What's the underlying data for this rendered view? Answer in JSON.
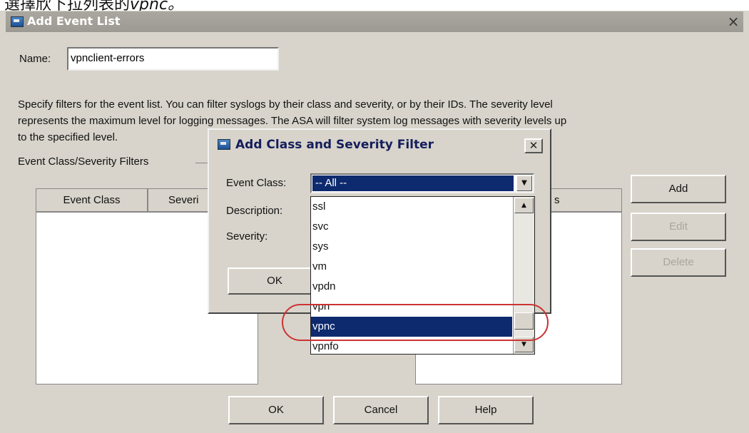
{
  "caption": {
    "prefix": "選擇欣下拉列表的",
    "italic": "vpnc。"
  },
  "main_dialog": {
    "title": "Add Event List",
    "close_glyph": "×",
    "name_label": "Name:",
    "name_value": "vpnclient-errors",
    "description_lines": [
      "Specify filters for the event list. You can filter syslogs by their class and severity, or by their IDs. The severity level",
      "represents the maximum level for logging messages. The ASA will filter system log messages with severity levels up",
      "to the specified level."
    ],
    "group_label": "Event Class/Severity Filters",
    "table_headers": [
      "Event Class",
      "Severi"
    ],
    "ids_header_partial": "s",
    "buttons": {
      "add": "Add",
      "edit": "Edit",
      "delete": "Delete"
    },
    "footer": {
      "ok": "OK",
      "cancel": "Cancel",
      "help": "Help"
    }
  },
  "sub_dialog": {
    "title": "Add Class and Severity Filter",
    "close_glyph": "✕",
    "event_class_label": "Event Class:",
    "event_class_value": "-- All --",
    "description_label": "Description:",
    "severity_label": "Severity:",
    "ok": "OK"
  },
  "dropdown": {
    "items": [
      "ssl",
      "svc",
      "sys",
      "vm",
      "vpdn",
      "vpn",
      "vpnc",
      "vpnfo"
    ],
    "selected": "vpnc"
  },
  "colors": {
    "selection": "#0d2a6e",
    "highlight_ring": "#cc3333",
    "dialog_bg": "#d8d4cb"
  }
}
